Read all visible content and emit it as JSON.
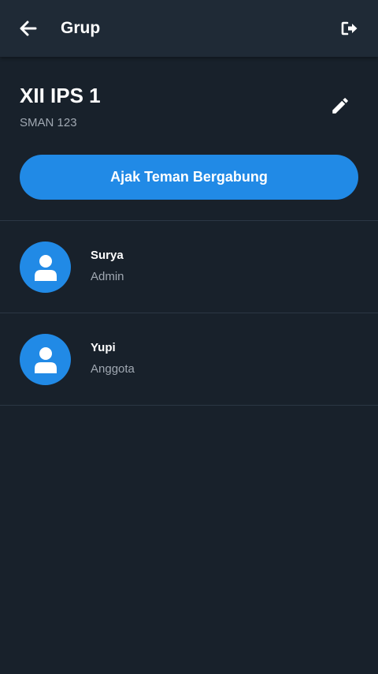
{
  "appbar": {
    "title": "Grup",
    "back_icon": "arrow-left-icon",
    "exit_icon": "exit-icon"
  },
  "group": {
    "name": "XII IPS 1",
    "school": "SMAN 123",
    "edit_icon": "pencil-icon"
  },
  "invite_button": {
    "label": "Ajak Teman Bergabung"
  },
  "members": [
    {
      "name": "Surya",
      "role": "Admin",
      "avatar_icon": "user-icon"
    },
    {
      "name": "Yupi",
      "role": "Anggota",
      "avatar_icon": "user-icon"
    }
  ],
  "colors": {
    "background": "#18212b",
    "appbar": "#1f2a36",
    "accent": "#218ae6",
    "secondary_text": "#a0a8b2"
  }
}
